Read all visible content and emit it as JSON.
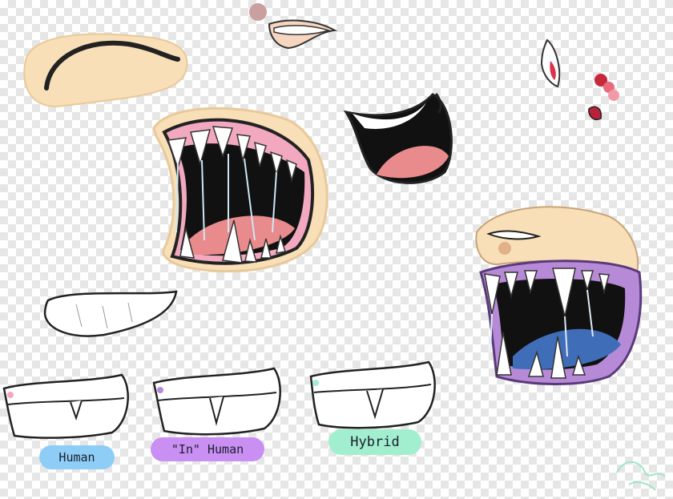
{
  "labels": {
    "human": "Human",
    "inhuman": "\"In\" Human",
    "hybrid": "Hybrid"
  },
  "colors": {
    "checker_dark": "#e6e6e6",
    "checker_light": "#ffffff",
    "skin": "#f8dfb7",
    "gum_pink": "#f2a9c0",
    "tongue": "#e98b8c",
    "purple_mouth": "#b68ad6",
    "blue_tongue": "#3f6db8",
    "human_tag": "#8ecdf5",
    "inhuman_tag": "#c98ff2",
    "hybrid_tag": "#a2efcf"
  }
}
